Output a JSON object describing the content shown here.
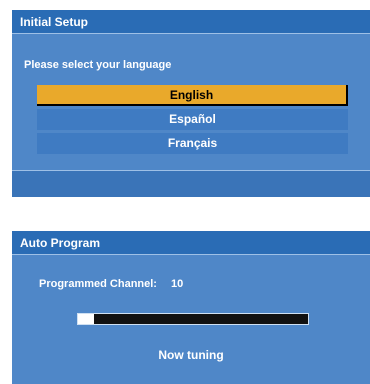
{
  "initial_setup": {
    "title": "Initial Setup",
    "prompt": "Please select your language",
    "languages": [
      {
        "label": "English",
        "selected": true
      },
      {
        "label": "Español",
        "selected": false
      },
      {
        "label": "Français",
        "selected": false
      }
    ]
  },
  "auto_program": {
    "title": "Auto Program",
    "channel_label": "Programmed Channel:",
    "channel_value": "10",
    "progress_fraction": 0.07,
    "status_text": "Now tuning"
  },
  "colors": {
    "panel_background": "#4f87c8",
    "header_background": "#2a6cb5",
    "selected_highlight": "#e9a92b",
    "progress_track": "#111111"
  }
}
